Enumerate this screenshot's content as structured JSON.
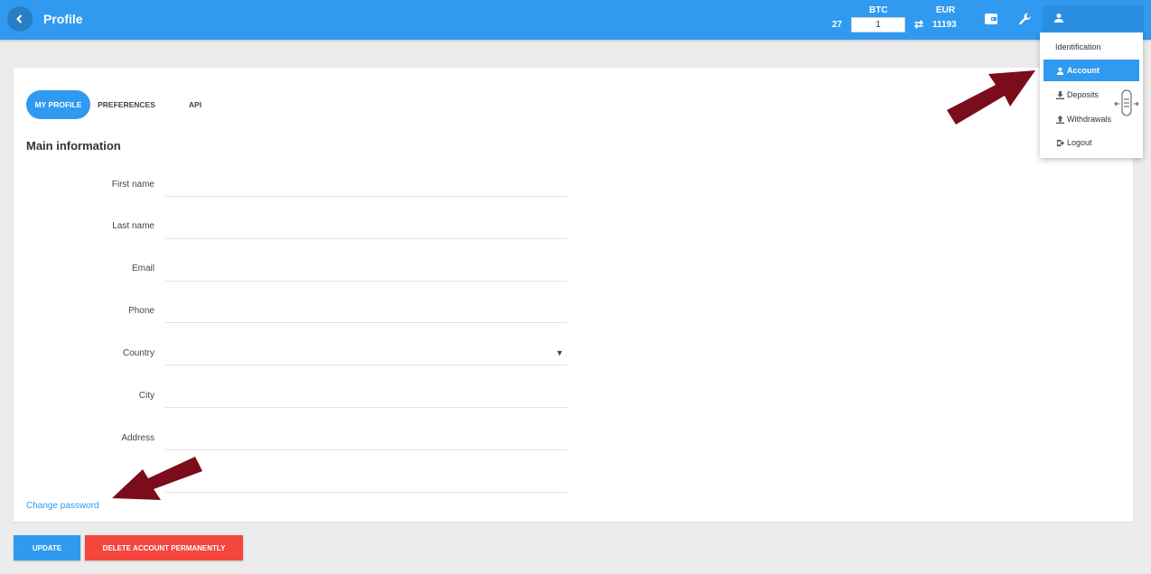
{
  "header": {
    "title": "Profile",
    "converter": {
      "btc_label": "BTC",
      "eur_label": "EUR",
      "btc_amount": "27",
      "input_value": "1",
      "eur_amount": "11193"
    }
  },
  "tabs": [
    {
      "label": "MY PROFILE"
    },
    {
      "label": "PREFERENCES"
    },
    {
      "label": "API"
    }
  ],
  "section_title": "Main information",
  "fields": {
    "first_name": "First name",
    "last_name": "Last name",
    "email": "Email",
    "phone": "Phone",
    "country": "Country",
    "city": "City",
    "address": "Address"
  },
  "change_password": "Change password",
  "buttons": {
    "update": "UPDATE",
    "delete": "DELETE ACCOUNT PERMANENTLY"
  },
  "user_menu": {
    "items": [
      {
        "label": "Identification",
        "icon": "none"
      },
      {
        "label": "Account",
        "icon": "person-icon"
      },
      {
        "label": "Deposits",
        "icon": "download-icon"
      },
      {
        "label": "Withdrawals",
        "icon": "upload-icon"
      },
      {
        "label": "Logout",
        "icon": "logout-icon"
      }
    ],
    "active_index": 1
  },
  "colors": {
    "primary": "#2f9af0",
    "danger": "#f4463c",
    "annotation_arrow": "#7a0c1c"
  }
}
